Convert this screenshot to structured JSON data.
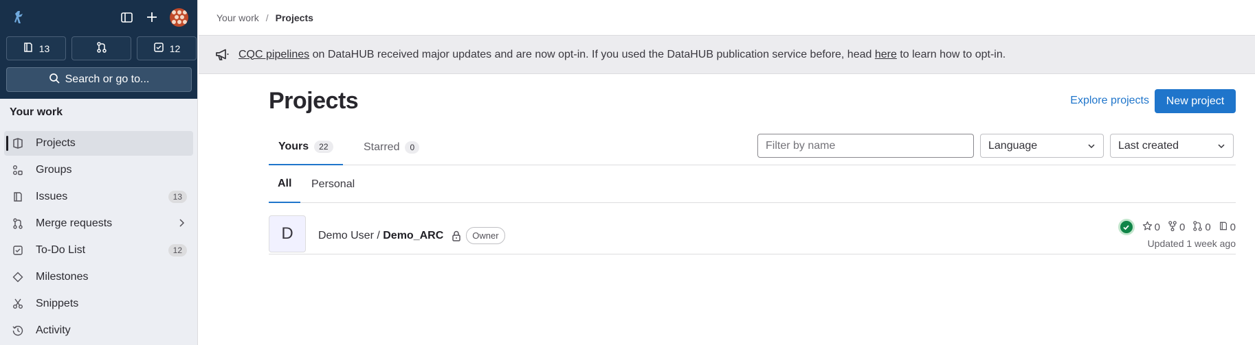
{
  "sidebar": {
    "counters": [
      {
        "icon": "issues-icon",
        "value": "13"
      },
      {
        "icon": "merge-request-icon",
        "value": ""
      },
      {
        "icon": "todo-icon",
        "value": "12"
      }
    ],
    "search_label": "Search or go to...",
    "section_title": "Your work",
    "items": [
      {
        "label": "Projects",
        "icon": "project-icon",
        "badge": ""
      },
      {
        "label": "Groups",
        "icon": "group-icon",
        "badge": ""
      },
      {
        "label": "Issues",
        "icon": "issues-icon",
        "badge": "13"
      },
      {
        "label": "Merge requests",
        "icon": "merge-request-icon",
        "badge": ""
      },
      {
        "label": "To-Do List",
        "icon": "todo-icon",
        "badge": "12"
      },
      {
        "label": "Milestones",
        "icon": "milestone-icon",
        "badge": ""
      },
      {
        "label": "Snippets",
        "icon": "snippet-icon",
        "badge": ""
      },
      {
        "label": "Activity",
        "icon": "history-icon",
        "badge": ""
      }
    ]
  },
  "breadcrumb": {
    "parent": "Your work",
    "current": "Projects"
  },
  "banner": {
    "link1": "CQC pipelines",
    "text1": " on DataHUB received major updates and are now opt-in. If you used the DataHUB publication service before, head ",
    "link2": "here",
    "text2": " to learn how to opt-in."
  },
  "page": {
    "title": "Projects",
    "explore_label": "Explore projects",
    "new_label": "New project",
    "tabs": [
      {
        "label": "Yours",
        "count": "22"
      },
      {
        "label": "Starred",
        "count": "0"
      }
    ],
    "filter_placeholder": "Filter by name",
    "language_label": "Language",
    "sort_label": "Last created",
    "subtabs": [
      "All",
      "Personal"
    ]
  },
  "project": {
    "avatar_letter": "D",
    "namespace": "Demo User / ",
    "name": "Demo_ARC",
    "role": "Owner",
    "stars": "0",
    "forks": "0",
    "merge_requests": "0",
    "issues": "0",
    "updated": "Updated 1 week ago"
  },
  "colors": {
    "sidebar_top": "#18304a",
    "accent": "#1f75cb",
    "ci_success": "#108548"
  }
}
